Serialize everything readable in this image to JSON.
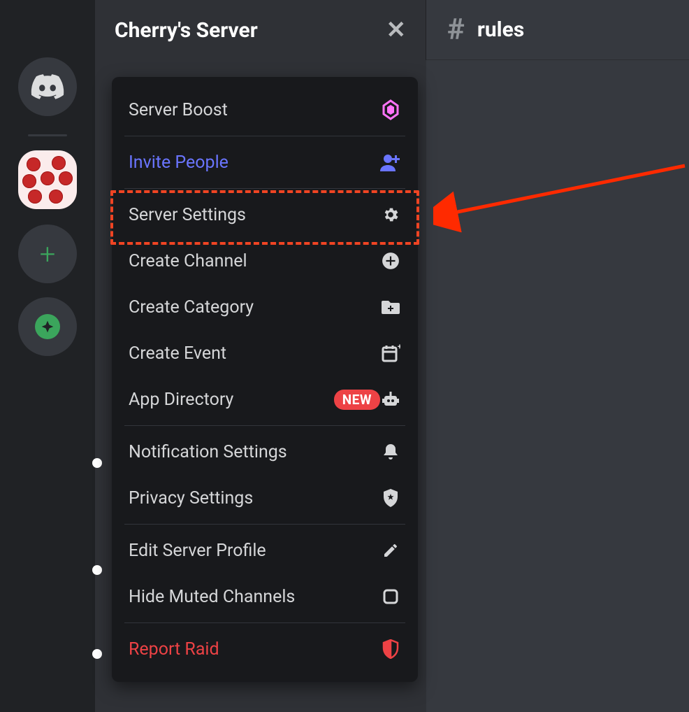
{
  "server_name": "Cherry's Server",
  "channel_name": "rules",
  "menu": {
    "boost": "Server Boost",
    "invite": "Invite People",
    "settings": "Server Settings",
    "create_channel": "Create Channel",
    "create_category": "Create Category",
    "create_event": "Create Event",
    "app_directory": "App Directory",
    "app_directory_badge": "NEW",
    "notification": "Notification Settings",
    "privacy": "Privacy Settings",
    "edit_profile": "Edit Server Profile",
    "hide_muted": "Hide Muted Channels",
    "report": "Report Raid"
  }
}
